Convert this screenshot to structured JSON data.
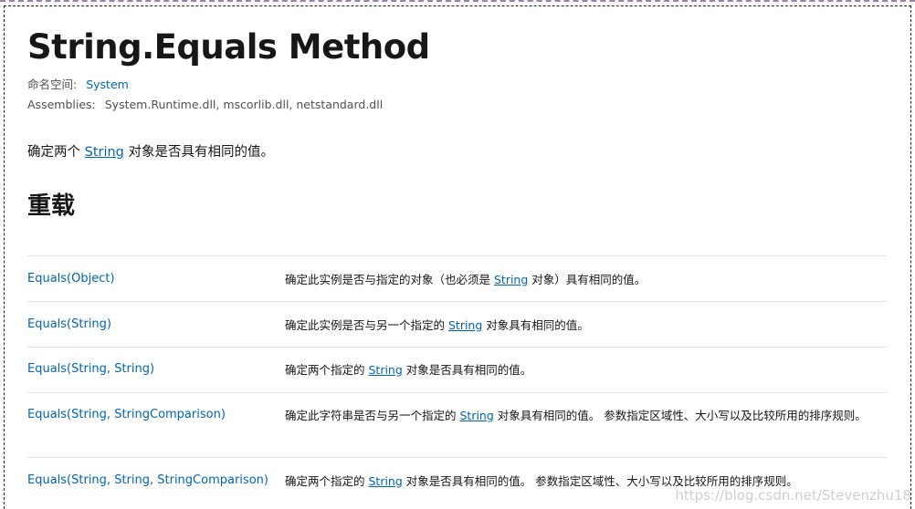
{
  "page": {
    "title": "String.Equals Method",
    "namespace_label": "命名空间:",
    "namespace_value": "System",
    "assemblies_label": "Assemblies:",
    "assemblies_value": "System.Runtime.dll, mscorlib.dll, netstandard.dll",
    "summary_before": "确定两个 ",
    "summary_link": "String",
    "summary_after": " 对象是否具有相同的值。",
    "overloads_heading": "重载"
  },
  "overloads": [
    {
      "method": "Equals(Object)",
      "desc_before": "确定此实例是否与指定的对象（也必须是 ",
      "desc_link": "String",
      "desc_after": " 对象）具有相同的值。"
    },
    {
      "method": "Equals(String)",
      "desc_before": "确定此实例是否与另一个指定的 ",
      "desc_link": "String",
      "desc_after": " 对象具有相同的值。"
    },
    {
      "method": "Equals(String, String)",
      "desc_before": "确定两个指定的 ",
      "desc_link": "String",
      "desc_after": " 对象是否具有相同的值。"
    },
    {
      "method": "Equals(String, StringComparison)",
      "desc_before": "确定此字符串是否与另一个指定的 ",
      "desc_link": "String",
      "desc_after": " 对象具有相同的值。 参数指定区域性、大小写以及比较所用的排序规则。"
    },
    {
      "method": "Equals(String, String, StringComparison)",
      "desc_before": "确定两个指定的 ",
      "desc_link": "String",
      "desc_after": " 对象是否具有相同的值。 参数指定区域性、大小写以及比较所用的排序规则。"
    }
  ],
  "watermark": "https://blog.csdn.net/Stevenzhu18",
  "colors": {
    "link": "#0065b3",
    "text": "#171717",
    "muted": "#505050",
    "divider": "#e3e3e3"
  }
}
